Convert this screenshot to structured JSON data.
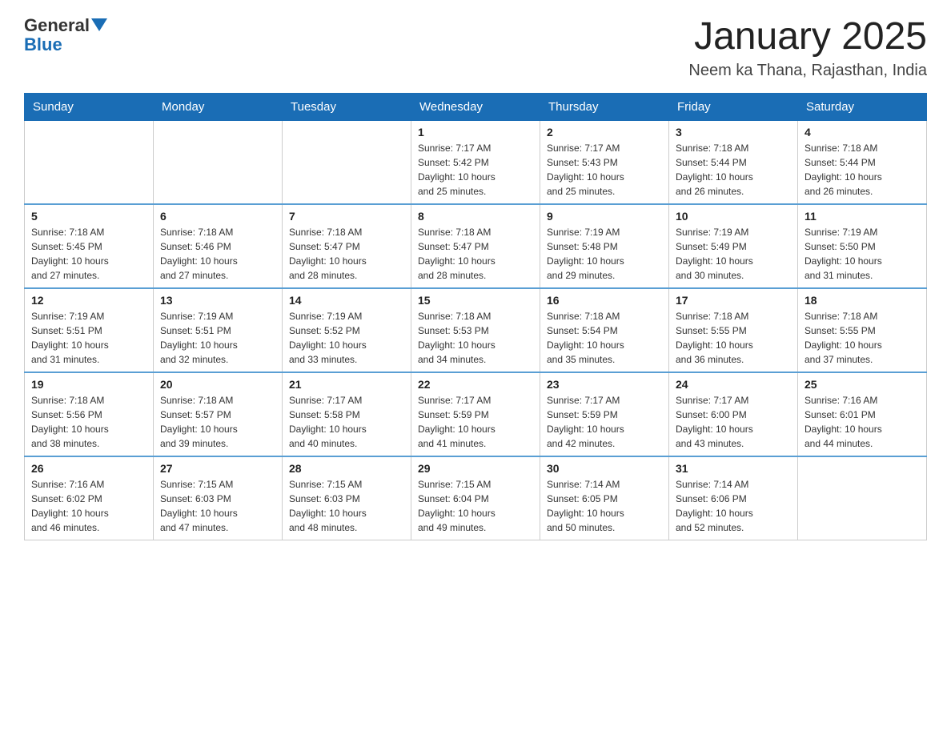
{
  "header": {
    "logo_general": "General",
    "logo_blue": "Blue",
    "main_title": "January 2025",
    "subtitle": "Neem ka Thana, Rajasthan, India"
  },
  "calendar": {
    "days_of_week": [
      "Sunday",
      "Monday",
      "Tuesday",
      "Wednesday",
      "Thursday",
      "Friday",
      "Saturday"
    ],
    "weeks": [
      [
        {
          "num": "",
          "info": ""
        },
        {
          "num": "",
          "info": ""
        },
        {
          "num": "",
          "info": ""
        },
        {
          "num": "1",
          "info": "Sunrise: 7:17 AM\nSunset: 5:42 PM\nDaylight: 10 hours\nand 25 minutes."
        },
        {
          "num": "2",
          "info": "Sunrise: 7:17 AM\nSunset: 5:43 PM\nDaylight: 10 hours\nand 25 minutes."
        },
        {
          "num": "3",
          "info": "Sunrise: 7:18 AM\nSunset: 5:44 PM\nDaylight: 10 hours\nand 26 minutes."
        },
        {
          "num": "4",
          "info": "Sunrise: 7:18 AM\nSunset: 5:44 PM\nDaylight: 10 hours\nand 26 minutes."
        }
      ],
      [
        {
          "num": "5",
          "info": "Sunrise: 7:18 AM\nSunset: 5:45 PM\nDaylight: 10 hours\nand 27 minutes."
        },
        {
          "num": "6",
          "info": "Sunrise: 7:18 AM\nSunset: 5:46 PM\nDaylight: 10 hours\nand 27 minutes."
        },
        {
          "num": "7",
          "info": "Sunrise: 7:18 AM\nSunset: 5:47 PM\nDaylight: 10 hours\nand 28 minutes."
        },
        {
          "num": "8",
          "info": "Sunrise: 7:18 AM\nSunset: 5:47 PM\nDaylight: 10 hours\nand 28 minutes."
        },
        {
          "num": "9",
          "info": "Sunrise: 7:19 AM\nSunset: 5:48 PM\nDaylight: 10 hours\nand 29 minutes."
        },
        {
          "num": "10",
          "info": "Sunrise: 7:19 AM\nSunset: 5:49 PM\nDaylight: 10 hours\nand 30 minutes."
        },
        {
          "num": "11",
          "info": "Sunrise: 7:19 AM\nSunset: 5:50 PM\nDaylight: 10 hours\nand 31 minutes."
        }
      ],
      [
        {
          "num": "12",
          "info": "Sunrise: 7:19 AM\nSunset: 5:51 PM\nDaylight: 10 hours\nand 31 minutes."
        },
        {
          "num": "13",
          "info": "Sunrise: 7:19 AM\nSunset: 5:51 PM\nDaylight: 10 hours\nand 32 minutes."
        },
        {
          "num": "14",
          "info": "Sunrise: 7:19 AM\nSunset: 5:52 PM\nDaylight: 10 hours\nand 33 minutes."
        },
        {
          "num": "15",
          "info": "Sunrise: 7:18 AM\nSunset: 5:53 PM\nDaylight: 10 hours\nand 34 minutes."
        },
        {
          "num": "16",
          "info": "Sunrise: 7:18 AM\nSunset: 5:54 PM\nDaylight: 10 hours\nand 35 minutes."
        },
        {
          "num": "17",
          "info": "Sunrise: 7:18 AM\nSunset: 5:55 PM\nDaylight: 10 hours\nand 36 minutes."
        },
        {
          "num": "18",
          "info": "Sunrise: 7:18 AM\nSunset: 5:55 PM\nDaylight: 10 hours\nand 37 minutes."
        }
      ],
      [
        {
          "num": "19",
          "info": "Sunrise: 7:18 AM\nSunset: 5:56 PM\nDaylight: 10 hours\nand 38 minutes."
        },
        {
          "num": "20",
          "info": "Sunrise: 7:18 AM\nSunset: 5:57 PM\nDaylight: 10 hours\nand 39 minutes."
        },
        {
          "num": "21",
          "info": "Sunrise: 7:17 AM\nSunset: 5:58 PM\nDaylight: 10 hours\nand 40 minutes."
        },
        {
          "num": "22",
          "info": "Sunrise: 7:17 AM\nSunset: 5:59 PM\nDaylight: 10 hours\nand 41 minutes."
        },
        {
          "num": "23",
          "info": "Sunrise: 7:17 AM\nSunset: 5:59 PM\nDaylight: 10 hours\nand 42 minutes."
        },
        {
          "num": "24",
          "info": "Sunrise: 7:17 AM\nSunset: 6:00 PM\nDaylight: 10 hours\nand 43 minutes."
        },
        {
          "num": "25",
          "info": "Sunrise: 7:16 AM\nSunset: 6:01 PM\nDaylight: 10 hours\nand 44 minutes."
        }
      ],
      [
        {
          "num": "26",
          "info": "Sunrise: 7:16 AM\nSunset: 6:02 PM\nDaylight: 10 hours\nand 46 minutes."
        },
        {
          "num": "27",
          "info": "Sunrise: 7:15 AM\nSunset: 6:03 PM\nDaylight: 10 hours\nand 47 minutes."
        },
        {
          "num": "28",
          "info": "Sunrise: 7:15 AM\nSunset: 6:03 PM\nDaylight: 10 hours\nand 48 minutes."
        },
        {
          "num": "29",
          "info": "Sunrise: 7:15 AM\nSunset: 6:04 PM\nDaylight: 10 hours\nand 49 minutes."
        },
        {
          "num": "30",
          "info": "Sunrise: 7:14 AM\nSunset: 6:05 PM\nDaylight: 10 hours\nand 50 minutes."
        },
        {
          "num": "31",
          "info": "Sunrise: 7:14 AM\nSunset: 6:06 PM\nDaylight: 10 hours\nand 52 minutes."
        },
        {
          "num": "",
          "info": ""
        }
      ]
    ]
  }
}
